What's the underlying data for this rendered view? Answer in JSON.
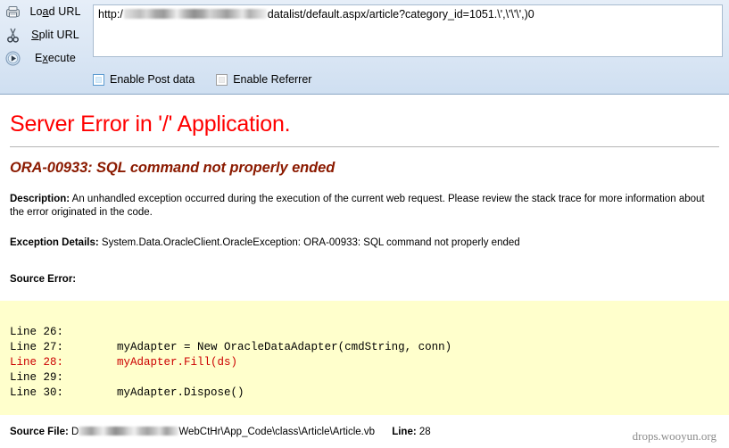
{
  "hackbar": {
    "buttons": [
      {
        "icon": "load-url-icon",
        "label_pre": "Lo",
        "label_accel": "a",
        "label_post": "d URL"
      },
      {
        "icon": "scissors-icon",
        "label_pre": "",
        "label_accel": "S",
        "label_post": "plit URL"
      },
      {
        "icon": "play-icon",
        "label_pre": "E",
        "label_accel": "x",
        "label_post": "ecute"
      }
    ],
    "url_prefix": "http:/",
    "url_suffix": "datalist/default.aspx/article?category_id=1051.\\',\\'\\'\\',)0",
    "checkboxes": [
      {
        "label": "Enable Post data",
        "checked": false,
        "style": "blue"
      },
      {
        "label": "Enable Referrer",
        "checked": false,
        "style": "gray"
      }
    ]
  },
  "error_page": {
    "title": "Server Error in '/' Application.",
    "exception_message": "ORA-00933: SQL command not properly ended",
    "description_label": "Description:",
    "description_text": "An unhandled exception occurred during the execution of the current web request. Please review the stack trace for more information about the error originated in the code.",
    "exception_details_label": "Exception Details:",
    "exception_details_text": "System.Data.OracleClient.OracleException: ORA-00933: SQL command not properly ended",
    "source_error_label": "Source Error:",
    "code": {
      "lines": [
        {
          "num": "Line 26:",
          "text": "",
          "highlight": false
        },
        {
          "num": "Line 27:",
          "text": "        myAdapter = New OracleDataAdapter(cmdString, conn)",
          "highlight": false
        },
        {
          "num": "Line 28:",
          "text": "        myAdapter.Fill(ds)",
          "highlight": true
        },
        {
          "num": "Line 29:",
          "text": "",
          "highlight": false
        },
        {
          "num": "Line 30:",
          "text": "        myAdapter.Dispose()",
          "highlight": false
        }
      ]
    },
    "source_file_label": "Source File:",
    "source_file_prefix": "D",
    "source_file_suffix": "WebCtHr\\App_Code\\class\\Article\\Article.vb",
    "line_label": "Line:",
    "line_value": "28"
  },
  "watermark": "drops.wooyun.org",
  "colors": {
    "error_red": "#ff0000",
    "exception_dark_red": "#8b1a00",
    "code_bg": "#ffffcc",
    "code_highlight": "#cc0000",
    "toolbar_bg": "#dde8f5"
  }
}
